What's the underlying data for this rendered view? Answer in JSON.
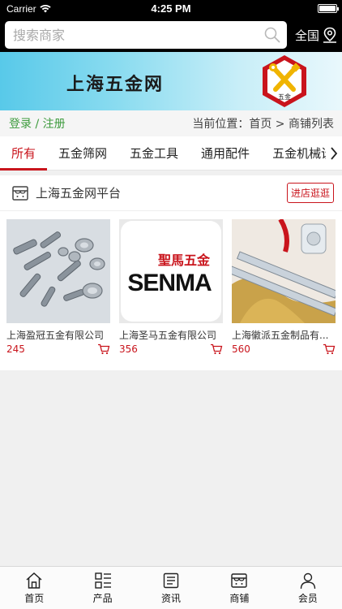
{
  "status_bar": {
    "carrier": "Carrier",
    "time": "4:25 PM",
    "battery_level": 1.0
  },
  "search": {
    "placeholder": "搜索商家",
    "region": "全国"
  },
  "banner": {
    "title": "上海五金网",
    "logo_text": "五金"
  },
  "breadcrumb": {
    "login": "登录 / 注册",
    "location": "当前位置：首页 > 商铺列表"
  },
  "tabs": [
    {
      "label": "所有",
      "active": true
    },
    {
      "label": "五金筛网",
      "active": false
    },
    {
      "label": "五金工具",
      "active": false
    },
    {
      "label": "通用配件",
      "active": false
    },
    {
      "label": "五金机械设",
      "active": false
    }
  ],
  "shop": {
    "name": "上海五金网平台",
    "visit_label": "进店逛逛",
    "products": [
      {
        "name": "上海盈冠五金有限公司",
        "price": "245"
      },
      {
        "name": "上海圣马五金有限公司",
        "price": "356",
        "image_text_cn": "聖馬五金",
        "image_text_en": "SENMA"
      },
      {
        "name": "上海徽派五金制品有...",
        "price": "560"
      }
    ]
  },
  "tabbar": [
    {
      "label": "首页",
      "icon": "home-icon"
    },
    {
      "label": "产品",
      "icon": "product-list-icon"
    },
    {
      "label": "资讯",
      "icon": "news-icon"
    },
    {
      "label": "商铺",
      "icon": "shop-icon"
    },
    {
      "label": "会员",
      "icon": "member-icon"
    }
  ],
  "colors": {
    "accent": "#c9141c",
    "login_green": "#3d9b3d",
    "banner": "#58c9e9"
  }
}
